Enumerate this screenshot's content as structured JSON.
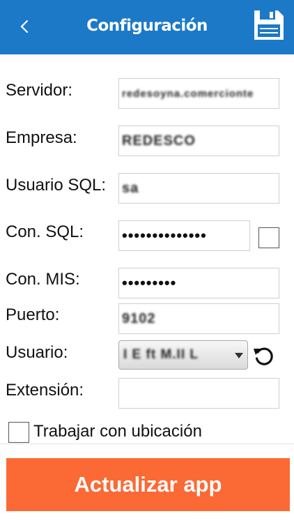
{
  "header": {
    "title": "Configuración",
    "back_icon": "chevron-left-icon",
    "save_icon": "floppy-disk-icon"
  },
  "colors": {
    "appbar": "#1b79c7",
    "accent_button": "#fb6935"
  },
  "form": {
    "server_label": "Servidor:",
    "server_value": "redesoyna.comercionte",
    "company_label": "Empresa:",
    "company_value": "REDESCO",
    "sql_user_label": "Usuario SQL:",
    "sql_user_value": "sa",
    "sql_pass_label": "Con. SQL:",
    "sql_pass_value": "••••••••••••••",
    "mis_pass_label": "Con. MIS:",
    "mis_pass_value": "•••••••••",
    "port_label": "Puerto:",
    "port_value": "9102",
    "user_label": "Usuario:",
    "user_value": "I E ft M.II L",
    "extension_label": "Extensión:",
    "extension_value": "",
    "location_label": "Trabajar con ubicación"
  },
  "actions": {
    "update_label": "Actualizar app",
    "refresh_icon": "refresh-icon"
  }
}
